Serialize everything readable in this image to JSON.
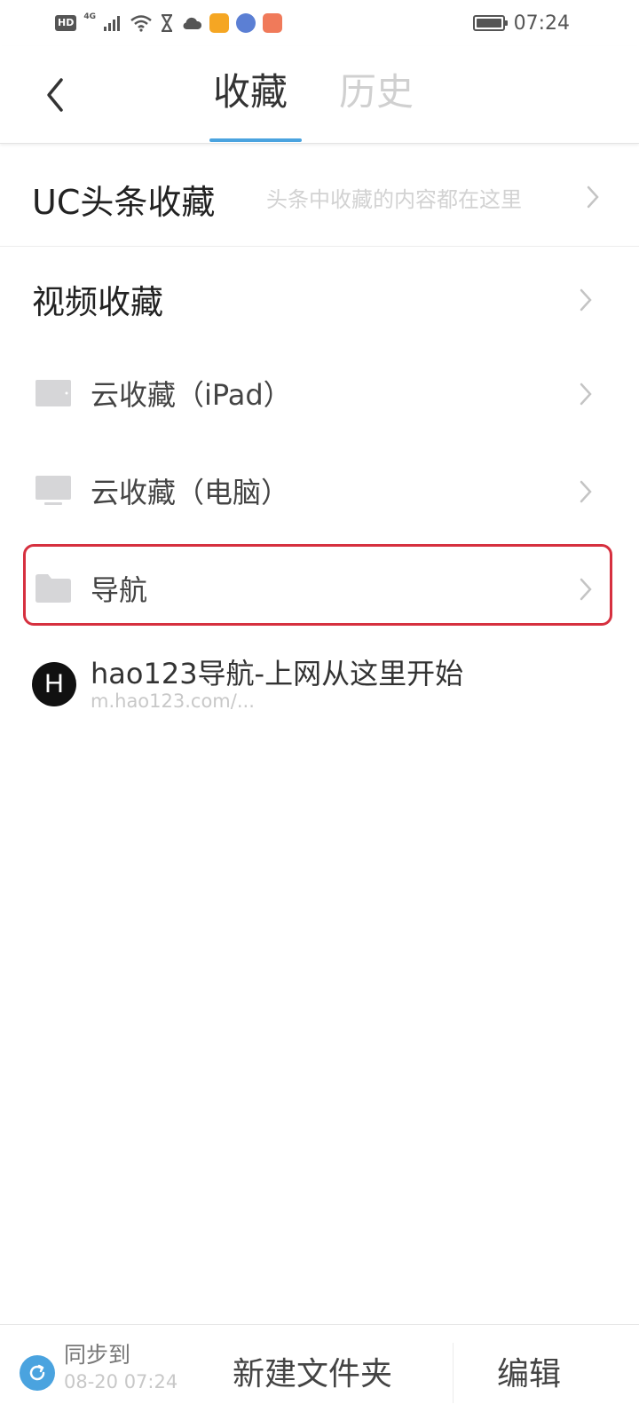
{
  "status_bar": {
    "hd": "HD",
    "network": "4G",
    "time": "07:24",
    "app_colors": [
      "#f5a623",
      "#5b7fd4",
      "#f07a5a"
    ]
  },
  "header": {
    "tabs": [
      {
        "label": "收藏",
        "active": true
      },
      {
        "label": "历史",
        "active": false
      }
    ],
    "accent_color": "#4aa3df"
  },
  "uc_headlines": {
    "title": "UC头条收藏",
    "description": "头条中收藏的内容都在这里"
  },
  "video": {
    "title": "视频收藏"
  },
  "folders": [
    {
      "label": "云收藏（iPad）",
      "icon": "tablet-icon"
    },
    {
      "label": "云收藏（电脑）",
      "icon": "monitor-icon"
    },
    {
      "label": "导航",
      "icon": "folder-icon",
      "highlighted": true
    }
  ],
  "bookmarks": [
    {
      "icon_letter": "H",
      "title": "hao123导航-上网从这里开始",
      "url": "m.hao123.com/..."
    }
  ],
  "bottom_bar": {
    "sync_label": "同步到",
    "sync_time": "08-20 07:24",
    "new_folder": "新建文件夹",
    "edit": "编辑"
  },
  "highlight_color": "#d6303f"
}
